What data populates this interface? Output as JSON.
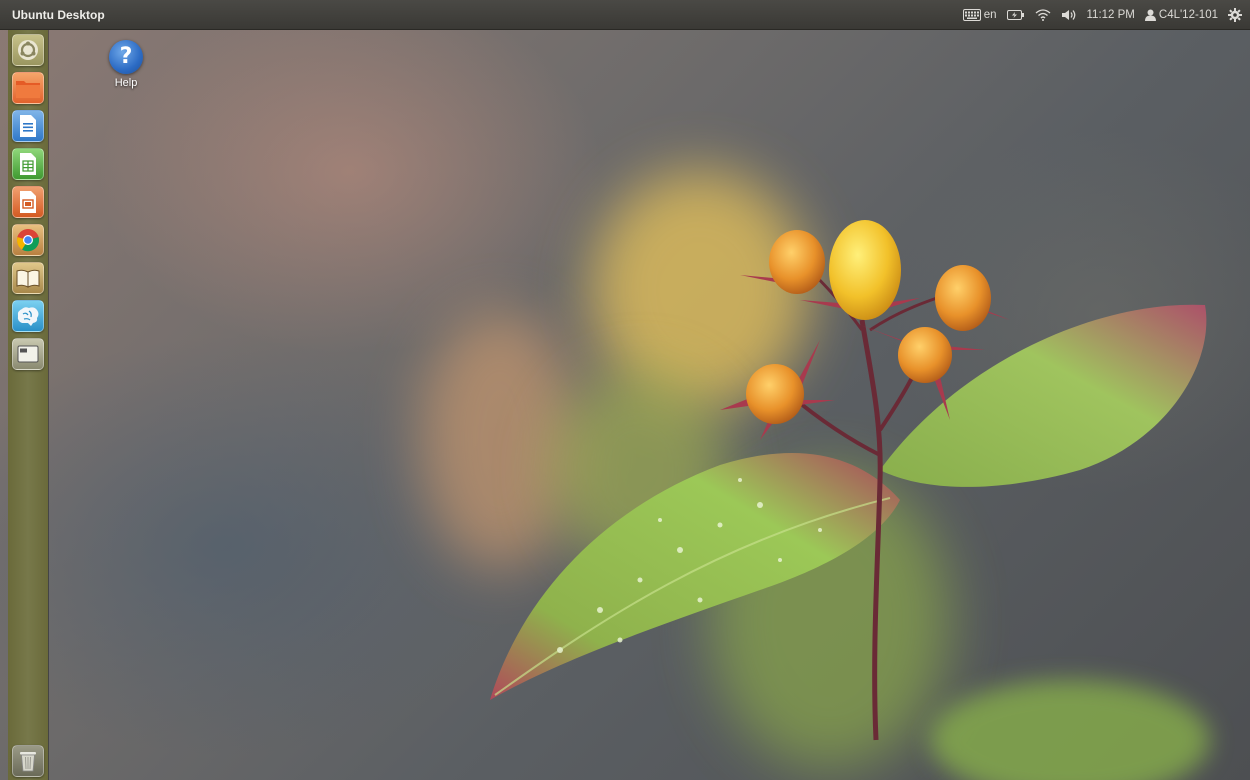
{
  "top_panel": {
    "title": "Ubuntu Desktop",
    "keyboard_layout": "en",
    "time": "11:12 PM",
    "username": "C4L'12-101",
    "indicator_icons": [
      "keyboard-icon",
      "battery-icon",
      "wifi-icon",
      "volume-icon",
      "user-icon",
      "settings-gear-icon"
    ]
  },
  "launcher": {
    "items": [
      {
        "name": "dash-home",
        "icon": "ubuntu-logo-icon"
      },
      {
        "name": "files",
        "icon": "folder-icon"
      },
      {
        "name": "writer",
        "icon": "document-icon"
      },
      {
        "name": "calc",
        "icon": "spreadsheet-icon"
      },
      {
        "name": "impress",
        "icon": "presentation-icon"
      },
      {
        "name": "chrome",
        "icon": "chrome-icon"
      },
      {
        "name": "ebook-reader",
        "icon": "book-icon"
      },
      {
        "name": "brain-app",
        "icon": "brain-icon"
      },
      {
        "name": "workspace-switcher",
        "icon": "workspace-icon"
      },
      {
        "name": "trash",
        "icon": "trash-icon"
      }
    ]
  },
  "desktop": {
    "icons": [
      {
        "label": "Help",
        "glyph": "?",
        "icon": "help-icon"
      }
    ]
  },
  "colors": {
    "panel_bg": "#3a3935",
    "launcher_bg": "#77784a",
    "help_blue": "#2c6bc4"
  }
}
